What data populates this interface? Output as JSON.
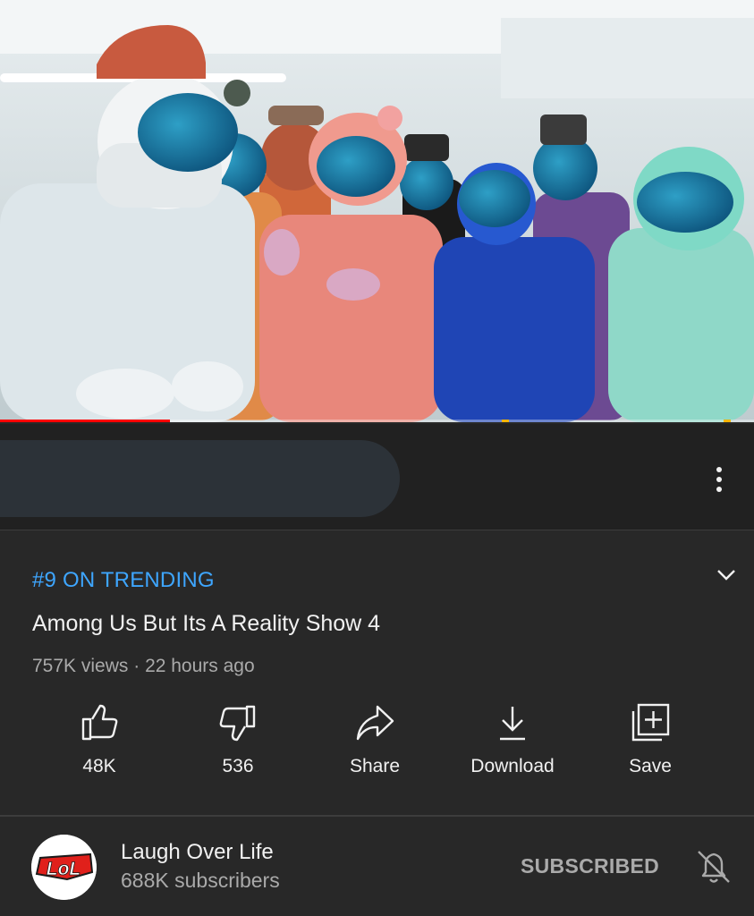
{
  "video": {
    "progress_fraction": 0.225,
    "buffer_marks": [
      0.665,
      0.96
    ]
  },
  "info": {
    "trending_label": "#9 ON TRENDING",
    "title": "Among Us But Its A Reality Show 4",
    "views": "757K views",
    "separator": " · ",
    "age": "22 hours ago"
  },
  "actions": {
    "like": {
      "label": "48K",
      "icon": "thumb-up-icon"
    },
    "dislike": {
      "label": "536",
      "icon": "thumb-down-icon"
    },
    "share": {
      "label": "Share",
      "icon": "share-arrow-icon"
    },
    "download": {
      "label": "Download",
      "icon": "download-icon"
    },
    "save": {
      "label": "Save",
      "icon": "playlist-add-icon"
    }
  },
  "channel": {
    "name": "Laugh Over Life",
    "subscribers": "688K subscribers",
    "avatar_text": "LoL",
    "subscribe_state": "SUBSCRIBED"
  },
  "colors": {
    "background": "#282828",
    "trending": "#3ea6ff",
    "progress": "#ff0000",
    "avatar_red": "#e0201b"
  }
}
